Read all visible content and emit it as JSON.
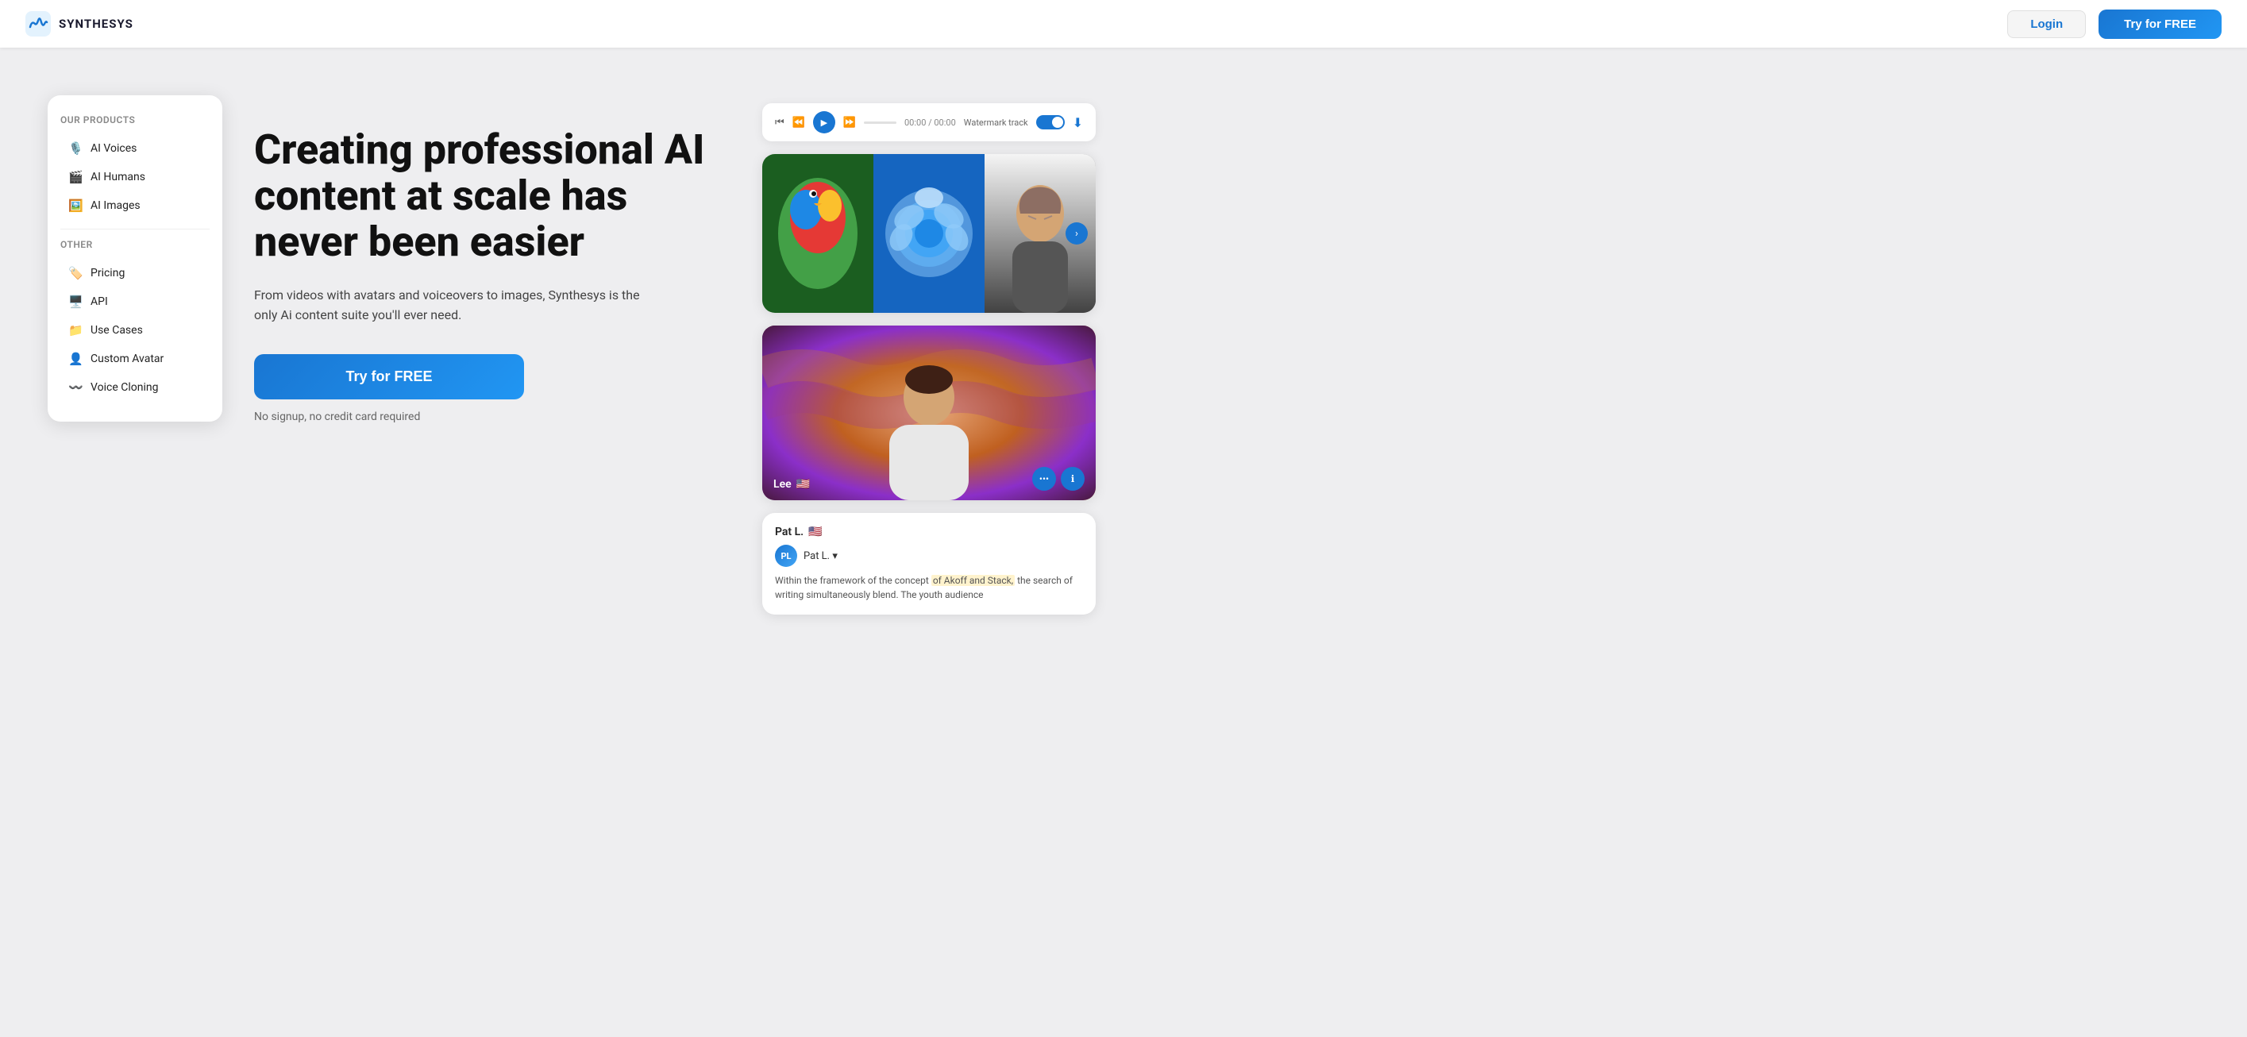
{
  "brand": {
    "name": "SYNTHESYS",
    "logo_alt": "Synthesys logo"
  },
  "nav": {
    "login_label": "Login",
    "try_free_label": "Try for FREE"
  },
  "dropdown": {
    "products_section": "Our products",
    "other_section": "Other",
    "items_products": [
      {
        "label": "AI Voices",
        "icon": "mic"
      },
      {
        "label": "AI Humans",
        "icon": "video"
      },
      {
        "label": "AI Images",
        "icon": "image"
      }
    ],
    "items_other": [
      {
        "label": "Pricing",
        "icon": "tag"
      },
      {
        "label": "API",
        "icon": "monitor"
      },
      {
        "label": "Use Cases",
        "icon": "folder"
      },
      {
        "label": "Custom Avatar",
        "icon": "person"
      },
      {
        "label": "Voice Cloning",
        "icon": "wave"
      }
    ]
  },
  "hero": {
    "title": "Creating professional AI content at scale has never been easier",
    "subtitle": "From videos with avatars and voiceovers to images, Synthesys is the only Ai content suite you'll ever need.",
    "cta_label": "Try for FREE",
    "no_signup_text": "No signup, no credit card required"
  },
  "video_player": {
    "time": "00:00 / 00:00",
    "watermark_label": "Watermark track"
  },
  "image_grid": {
    "images": [
      {
        "alt": "Colorful parrot"
      },
      {
        "alt": "Blue rose"
      },
      {
        "alt": "Elder person portrait"
      }
    ]
  },
  "avatar_card": {
    "name": "Lee",
    "flag": "🇺🇸"
  },
  "review_card": {
    "reviewer_name": "Pat L.",
    "reviewer_flag": "🇺🇸",
    "avatar_initials": "PL",
    "reviewer_handle": "Pat L. ▾",
    "text_before": "Within the framework of the concept",
    "highlight": "of Akoff and Stack,",
    "text_after": " the search of writing simultaneously blend. The youth audience"
  }
}
